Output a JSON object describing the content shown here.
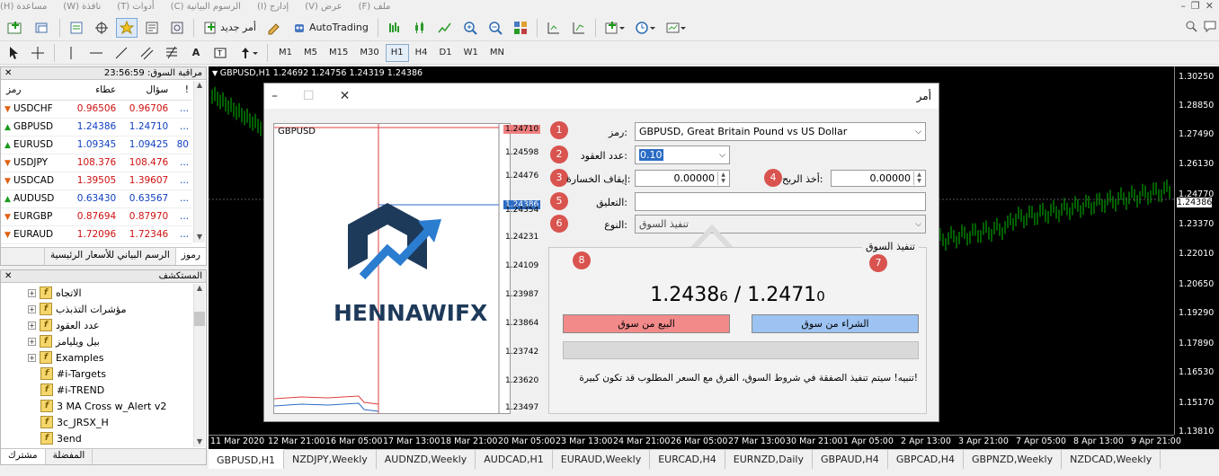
{
  "menubar": {
    "items": [
      "ملف (F)",
      "عرض (V)",
      "إدارج (I)",
      "الرسوم البيانية (C)",
      "أدوات (T)",
      "نافذة (W)",
      "مساعدة (H)"
    ]
  },
  "toolbar": {
    "new_order": "أمر جديد",
    "autotrading": "AutoTrading",
    "timeframes": [
      "M1",
      "M5",
      "M15",
      "M30",
      "H1",
      "H4",
      "D1",
      "W1",
      "MN"
    ],
    "active_timeframe": "H1"
  },
  "market_watch": {
    "title": "مراقبة السوق: 23:56:59",
    "headers": {
      "symbol": "رمز",
      "bid": "عطاء",
      "ask": "سؤال",
      "extra": "!"
    },
    "rows": [
      {
        "symbol": "USDCHF",
        "bid": "0.96506",
        "ask": "0.96706",
        "extra": "...",
        "dir": "down"
      },
      {
        "symbol": "GBPUSD",
        "bid": "1.24386",
        "ask": "1.24710",
        "extra": "...",
        "dir": "up"
      },
      {
        "symbol": "EURUSD",
        "bid": "1.09345",
        "ask": "1.09425",
        "extra": "80",
        "dir": "up"
      },
      {
        "symbol": "USDJPY",
        "bid": "108.376",
        "ask": "108.476",
        "extra": "...",
        "dir": "down"
      },
      {
        "symbol": "USDCAD",
        "bid": "1.39505",
        "ask": "1.39607",
        "extra": "...",
        "dir": "down"
      },
      {
        "symbol": "AUDUSD",
        "bid": "0.63430",
        "ask": "0.63567",
        "extra": "...",
        "dir": "up"
      },
      {
        "symbol": "EURGBP",
        "bid": "0.87694",
        "ask": "0.87970",
        "extra": "...",
        "dir": "down"
      },
      {
        "symbol": "EURAUD",
        "bid": "1.72096",
        "ask": "1.72346",
        "extra": "...",
        "dir": "down"
      }
    ],
    "tabs": [
      "رموز",
      "الرسم البياني للأسعار الرئيسية"
    ]
  },
  "navigator": {
    "title": "المستكشف",
    "items": [
      "الاتجاه",
      "مؤشرات التذبذب",
      "عدد العقود",
      "بيل ويليامز",
      "Examples",
      "#i-Targets",
      "#i-TREND",
      "3 MA Cross w_Alert v2",
      "3c_JRSX_H",
      "3end"
    ],
    "tabs": [
      "مشترك",
      "المفضلة"
    ]
  },
  "chart": {
    "info": "GBPUSD,H1  1.24692 1.24756 1.24319 1.24386",
    "price_labels": [
      "1.30250",
      "1.28850",
      "1.27490",
      "1.26130",
      "1.24770",
      "1.24386",
      "1.23370",
      "1.22010",
      "1.20650",
      "1.19290",
      "1.17890",
      "1.16530",
      "1.15170",
      "1.13810"
    ],
    "time_labels": [
      "11 Mar 2020",
      "12 Mar 21:00",
      "16 Mar 05:00",
      "17 Mar 13:00",
      "18 Mar 21:00",
      "20 Mar 05:00",
      "23 Mar 13:00",
      "24 Mar 21:00",
      "26 Mar 05:00",
      "27 Mar 13:00",
      "30 Mar 21:00",
      "1 Apr 05:00",
      "2 Apr 13:00",
      "3 Apr 21:00",
      "7 Apr 05:00",
      "8 Apr 13:00",
      "9 Apr 21:00"
    ]
  },
  "bottom_tabs": [
    "GBPUSD,H1",
    "NZDJPY,Weekly",
    "AUDNZD,Weekly",
    "AUDCAD,H1",
    "EURAUD,Weekly",
    "EURCAD,H4",
    "EURNZD,Daily",
    "GBPAUD,H4",
    "GBPCAD,H4",
    "GBPNZD,Weekly",
    "NZDCAD,Weekly"
  ],
  "order_dialog": {
    "title": "أمر",
    "symbol_label": "رمز:",
    "symbol_value": "GBPUSD, Great Britain Pound vs US Dollar",
    "volume_label": "عدد العقود:",
    "volume_value": "0.10",
    "stoploss_label": "إيقاف الخسارة:",
    "stoploss_value": "0.00000",
    "takeprofit_label": "أخذ الربح:",
    "takeprofit_value": "0.00000",
    "comment_label": "التعليق:",
    "comment_value": "",
    "type_label": "النوع:",
    "type_value": "تنفيذ السوق",
    "group_title": "تنفيذ السوق",
    "bid_main": "1.2438",
    "bid_last": "6",
    "separator": " / ",
    "ask_main": "1.2471",
    "ask_last": "0",
    "sell_button": "البيع من سوق",
    "buy_button": "الشراء من سوق",
    "warning": "!تنبيه! سيتم تنفيذ الصفقة في شروط السوق، الفرق مع السعر المطلوب قد تكون كبيرة",
    "badges": [
      "1",
      "2",
      "3",
      "4",
      "5",
      "6",
      "7",
      "8"
    ],
    "mini_chart": {
      "symbol": "GBPUSD",
      "price_labels": [
        "1.24710",
        "1.24598",
        "1.24476",
        "1.24386",
        "1.24354",
        "1.24231",
        "1.24109",
        "1.23987",
        "1.23864",
        "1.23742",
        "1.23620",
        "1.23497"
      ],
      "watermark": "HENNAWIFX"
    }
  },
  "colors": {
    "bull": "#00c000",
    "bear": "#ff4040",
    "sell_btn": "#f28a8a",
    "buy_btn": "#9cc3f2",
    "badge": "#d9534f"
  }
}
